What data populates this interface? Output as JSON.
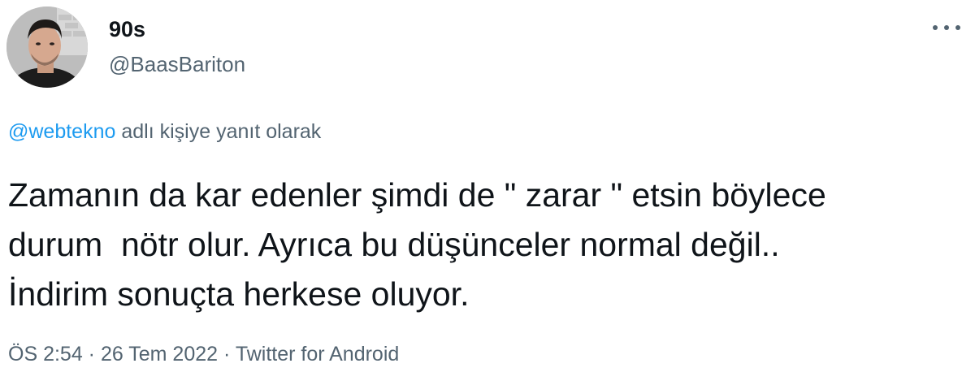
{
  "author": {
    "display_name": "90s",
    "handle": "@BaasBariton",
    "avatar": "profile-photo"
  },
  "more_icon": "more-horizontal-icon",
  "reply": {
    "mention": "@webtekno",
    "suffix": " adlı kişiye yanıt olarak"
  },
  "tweet": {
    "lines": [
      "Zamanın da kar edenler şimdi de \" zarar \" etsin böylece",
      "durum  nötr olur. Ayrıca bu düşünceler normal değil..",
      "İndirim sonuçta herkese oluyor."
    ]
  },
  "meta": {
    "time": "ÖS 2:54",
    "separator": " · ",
    "date": "26 Tem 2022",
    "source": "Twitter for Android"
  },
  "colors": {
    "text": "#0f1419",
    "secondary": "#536471",
    "link": "#1d9bf0"
  }
}
